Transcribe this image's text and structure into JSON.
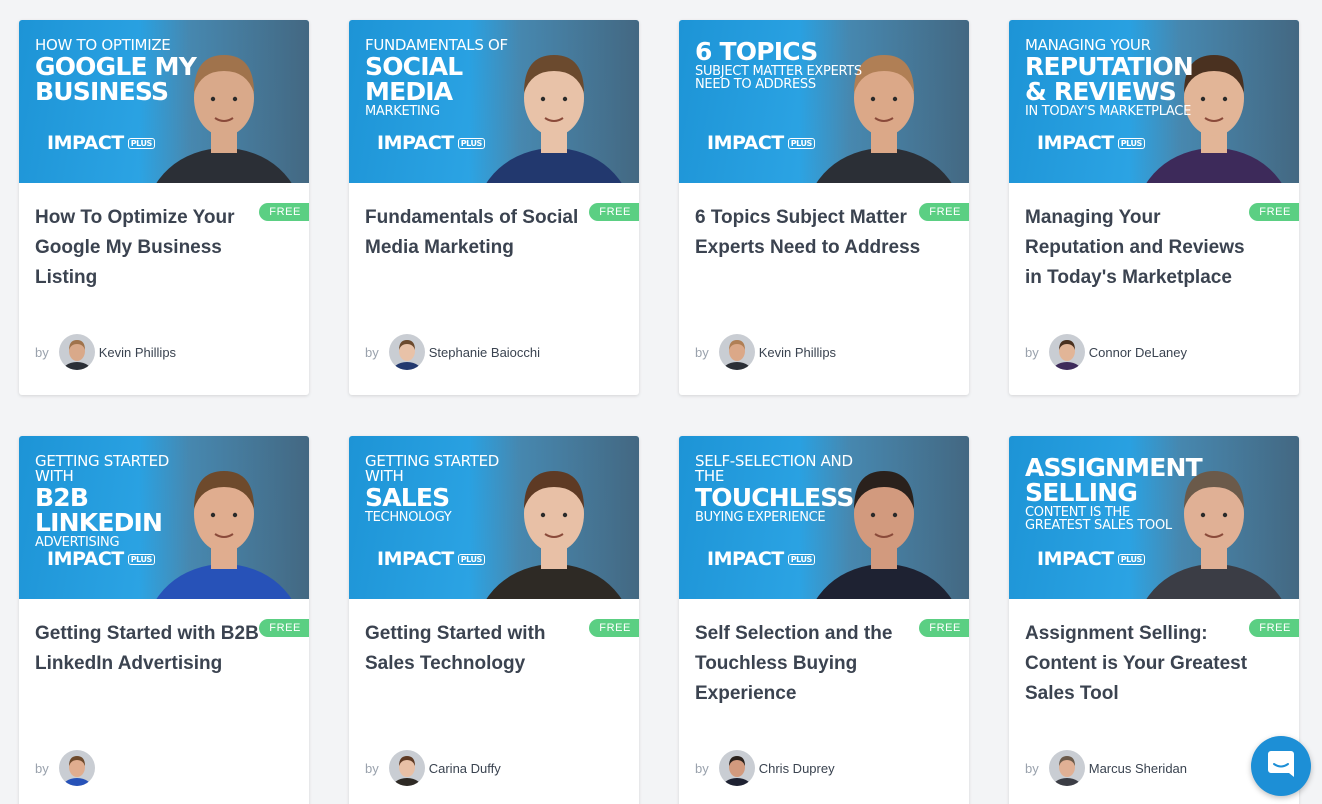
{
  "courses": [
    {
      "title": "How To Optimize Your Google My Business Listing",
      "badge": "FREE",
      "by": "by",
      "author": "Kevin Phillips",
      "thumb": {
        "line1": "How to Optimize",
        "line2": "Google My Business",
        "line3": "",
        "logo": "IMPACT",
        "logo_plus": "PLUS"
      },
      "skin": "#d9a98a",
      "hair": "#a0734c",
      "shirt": "#2b2f36"
    },
    {
      "title": "Fundamentals of Social Media Marketing",
      "badge": "FREE",
      "by": "by",
      "author": "Stephanie Baiocchi",
      "thumb": {
        "line1": "Fundamentals of",
        "line2": "Social Media",
        "line3": "Marketing",
        "logo": "IMPACT",
        "logo_plus": "PLUS"
      },
      "skin": "#e8c2a8",
      "hair": "#6b4a2e",
      "shirt": "#22386e"
    },
    {
      "title": "6 Topics Subject Matter Experts Need to Address",
      "badge": "FREE",
      "by": "by",
      "author": "Kevin Phillips",
      "thumb": {
        "line1": "",
        "line2": "6 Topics",
        "line3": "Subject Matter Experts Need to Address",
        "logo": "IMPACT",
        "logo_plus": "PLUS"
      },
      "skin": "#dba888",
      "hair": "#b07f55",
      "shirt": "#2b2f36"
    },
    {
      "title": "Managing Your Reputation and Reviews in Today's Marketplace",
      "badge": "FREE",
      "by": "by",
      "author": "Connor DeLaney",
      "thumb": {
        "line1": "Managing Your",
        "line2": "Reputation & Reviews",
        "line3": "In Today's Marketplace",
        "logo": "IMPACT",
        "logo_plus": "PLUS"
      },
      "skin": "#e2b597",
      "hair": "#4a3120",
      "shirt": "#3d2a5a"
    },
    {
      "title": "Getting Started with B2B LinkedIn Advertising",
      "badge": "FREE",
      "by": "by",
      "author": "",
      "thumb": {
        "line1": "Getting Started With",
        "line2": "B2B LinkedIn",
        "line3": "Advertising",
        "logo": "IMPACT",
        "logo_plus": "PLUS"
      },
      "skin": "#e0ad8f",
      "hair": "#6e4a2c",
      "shirt": "#2752b8"
    },
    {
      "title": "Getting Started with Sales Technology",
      "badge": "FREE",
      "by": "by",
      "author": "Carina Duffy",
      "thumb": {
        "line1": "Getting Started With",
        "line2": "Sales",
        "line3": "Technology",
        "logo": "IMPACT",
        "logo_plus": "PLUS"
      },
      "skin": "#e8c0a6",
      "hair": "#5e3a24",
      "shirt": "#2e2a25"
    },
    {
      "title": "Self Selection and the Touchless Buying Experience",
      "badge": "FREE",
      "by": "by",
      "author": "Chris Duprey",
      "thumb": {
        "line1": "Self-Selection and the",
        "line2": "Touchless",
        "line3": "Buying Experience",
        "logo": "IMPACT",
        "logo_plus": "PLUS"
      },
      "skin": "#d29a7e",
      "hair": "#2a211c",
      "shirt": "#1e2232"
    },
    {
      "title": "Assignment Selling: Content is Your Greatest Sales Tool",
      "badge": "FREE",
      "by": "by",
      "author": "Marcus Sheridan",
      "thumb": {
        "line1": "",
        "line2": "Assignment Selling",
        "line3": "Content is the Greatest Sales Tool",
        "logo": "IMPACT",
        "logo_plus": "PLUS"
      },
      "skin": "#e0b095",
      "hair": "#6b5a4a",
      "shirt": "#3b3d45"
    }
  ],
  "chat": {
    "icon": "chat-icon",
    "color": "#1d8fd6"
  },
  "badge_color": "#5bcf83"
}
